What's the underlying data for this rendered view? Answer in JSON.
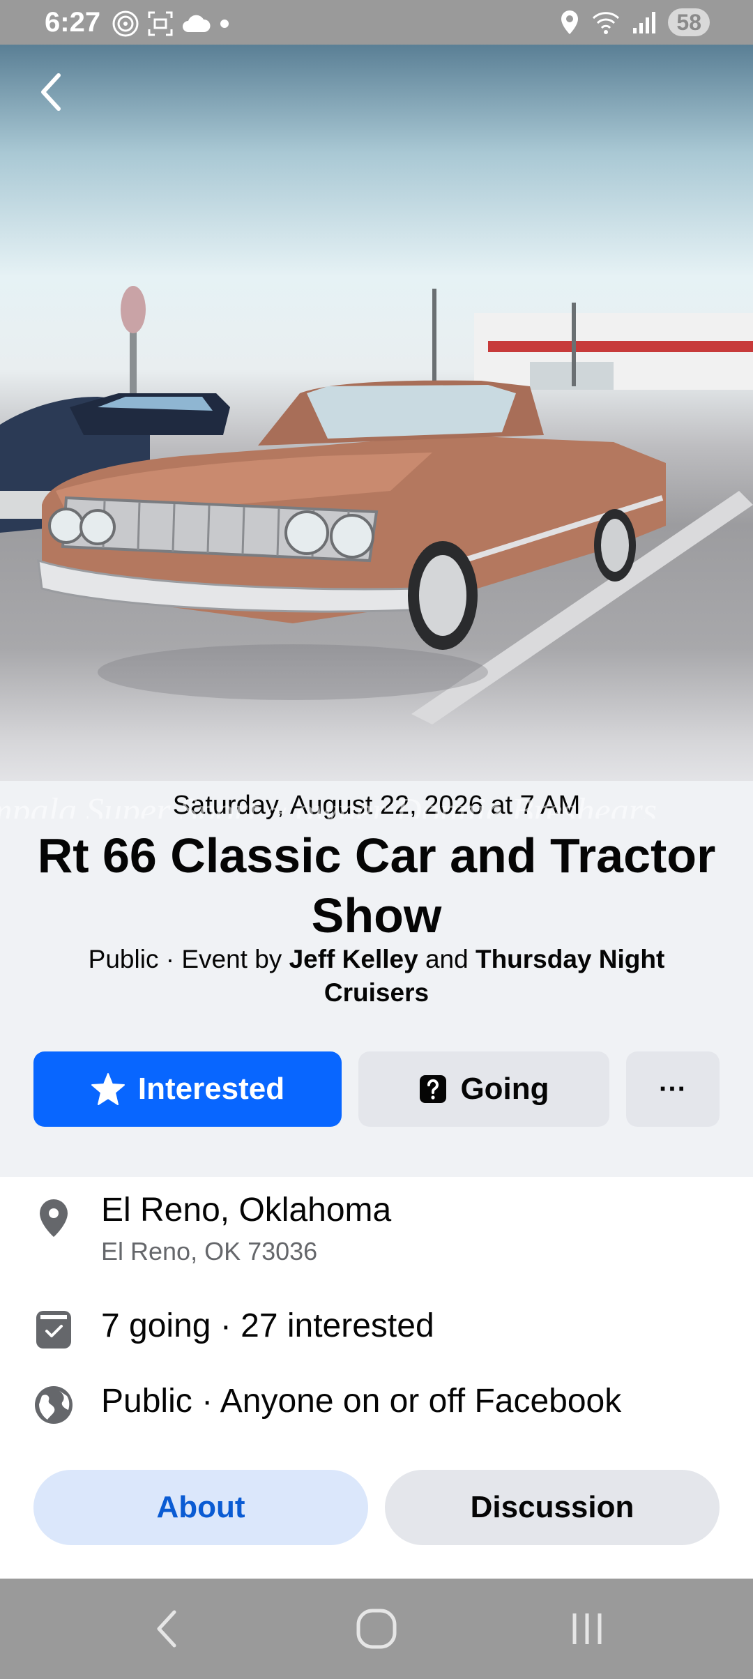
{
  "status_bar": {
    "time": "6:27",
    "battery": "58",
    "icons_left": [
      "hotspot-icon",
      "screenshot-icon",
      "cloud-icon",
      "dot-icon"
    ],
    "icons_right": [
      "location-icon",
      "wifi-icon",
      "signal-icon"
    ]
  },
  "hero": {
    "watermark": "mpala Super Sport ~ owner Donnie Breshears"
  },
  "event": {
    "date": "Saturday, August 22, 2026 at 7 AM",
    "title": "Rt 66 Classic Car and Tractor Show",
    "host_prefix": "Public · Event by ",
    "host_1": "Jeff Kelley",
    "host_and": " and ",
    "host_2": "Thursday Night Cruisers"
  },
  "actions": {
    "interested_label": "Interested",
    "going_label": "Going",
    "more_label": "···"
  },
  "details": {
    "location_name": "El Reno, Oklahoma",
    "location_address": "El Reno, OK 73036",
    "attendance": "7 going · 27 interested",
    "privacy": "Public · Anyone on or off Facebook"
  },
  "tabs": {
    "about": "About",
    "discussion": "Discussion"
  },
  "colors": {
    "accent": "#0866ff",
    "button_gray": "#e4e6eb",
    "tab_active_bg": "#dbe7fb",
    "tab_active_text": "#0a5bd3"
  }
}
